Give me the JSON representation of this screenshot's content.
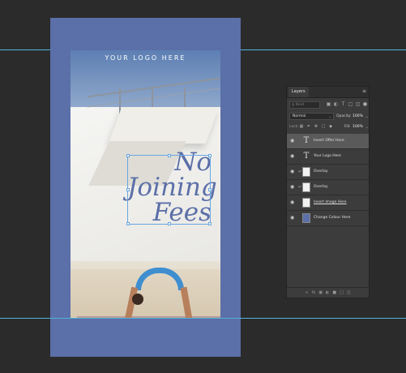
{
  "artboard": {
    "logo_text": "YOUR LOGO HERE",
    "headline": [
      "No",
      "Joining",
      "Fees"
    ],
    "bg_color": "#5b6fa8"
  },
  "layers_panel": {
    "tab_label": "Layers",
    "kind_placeholder": "Kind",
    "blend_mode": "Normal",
    "opacity_label": "Opacity:",
    "opacity_value": "100%",
    "lock_label": "Lock:",
    "fill_label": "Fill:",
    "fill_value": "100%",
    "layers": [
      {
        "name": "Insert Offer Here",
        "thumb": "text",
        "selected": true
      },
      {
        "name": "Your Logo Here",
        "thumb": "text",
        "selected": false
      },
      {
        "name": "Overlay",
        "thumb": "doc",
        "selected": false
      },
      {
        "name": "Overlay",
        "thumb": "doc",
        "selected": false
      },
      {
        "name": "Insert Image Here",
        "thumb": "img",
        "selected": false
      },
      {
        "name": "Change Colour Here",
        "thumb": "color",
        "selected": false
      }
    ],
    "footer_icons": [
      "link-icon",
      "fx-icon",
      "mask-icon",
      "adjustment-icon",
      "folder-icon",
      "new-layer-icon",
      "trash-icon"
    ]
  }
}
